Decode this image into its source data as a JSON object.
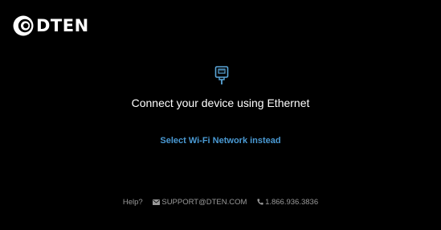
{
  "brand": {
    "name": "DTEN",
    "logo_icon": "dten-logo-mark"
  },
  "main": {
    "icon": "ethernet-icon",
    "title": "Connect your device using Ethernet",
    "wifi_link": "Select Wi-Fi Network instead"
  },
  "footer": {
    "help_label": "Help?",
    "email": "SUPPORT@DTEN.COM",
    "email_icon": "mail-icon",
    "phone": "1.866.936.3836",
    "phone_icon": "phone-icon"
  },
  "colors": {
    "background": "#000000",
    "text": "#ffffff",
    "link": "#4a9ad4",
    "icon": "#5aa6d8",
    "footer_text": "#9a9a9a"
  }
}
